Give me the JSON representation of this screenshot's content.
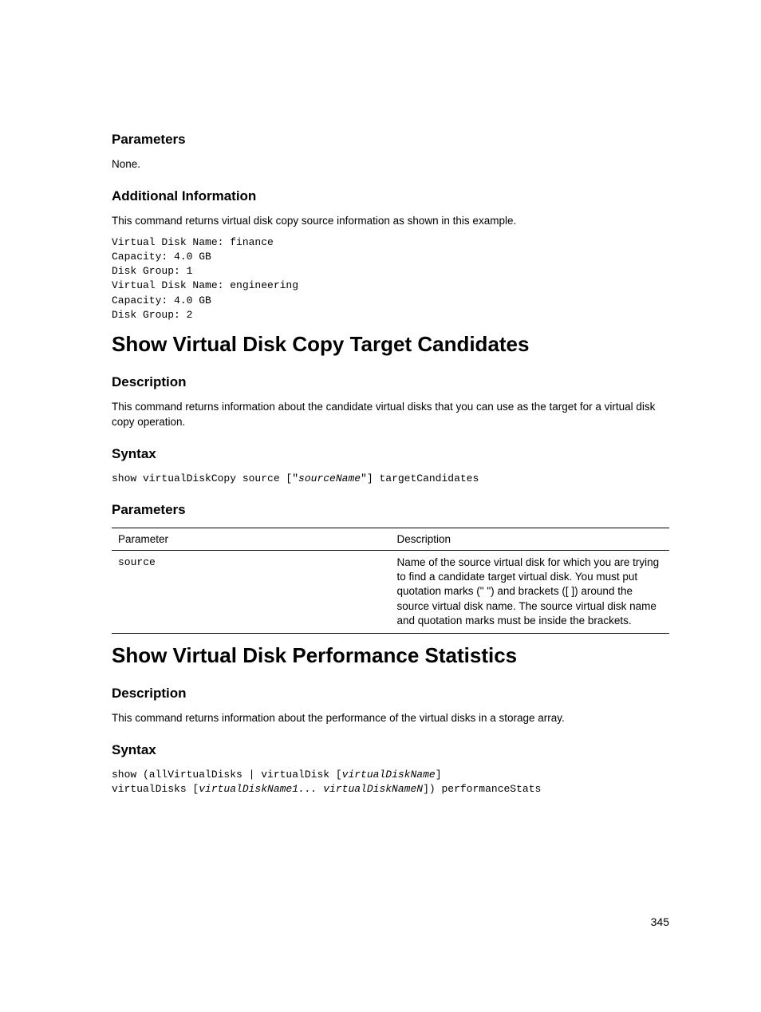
{
  "section1": {
    "h_params": "Parameters",
    "params_none": "None.",
    "h_addinfo": "Additional Information",
    "addinfo_text": "This command returns virtual disk copy source information as shown in this example.",
    "code": "Virtual Disk Name: finance\nCapacity: 4.0 GB\nDisk Group: 1\nVirtual Disk Name: engineering\nCapacity: 4.0 GB\nDisk Group: 2"
  },
  "section2": {
    "title": "Show Virtual Disk Copy Target Candidates",
    "h_desc": "Description",
    "desc_text": "This command returns information about the candidate virtual disks that you can use as the target for a virtual disk copy operation.",
    "h_syntax": "Syntax",
    "syntax_pre": "show virtualDiskCopy source [\"",
    "syntax_italic": "sourceName",
    "syntax_post": "\"] targetCandidates",
    "h_params": "Parameters",
    "table": {
      "col1": "Parameter",
      "col2": "Description",
      "row1_param": "source",
      "row1_desc": "Name of the source virtual disk for which you are trying to find a candidate target virtual disk. You must put quotation marks (\" \") and brackets ([ ]) around the source virtual disk name. The source virtual disk name and quotation marks must be inside the brackets."
    }
  },
  "section3": {
    "title": "Show Virtual Disk Performance Statistics",
    "h_desc": "Description",
    "desc_text": "This command returns information about the performance of the virtual disks in a storage array.",
    "h_syntax": "Syntax",
    "syntax_l1_pre": "show (allVirtualDisks | virtualDisk [",
    "syntax_l1_italic": "virtualDiskName",
    "syntax_l1_post": "]",
    "syntax_l2_pre": "virtualDisks [",
    "syntax_l2_italic": "virtualDiskName1... virtualDiskNameN",
    "syntax_l2_post": "]) performanceStats"
  },
  "page_number": "345"
}
